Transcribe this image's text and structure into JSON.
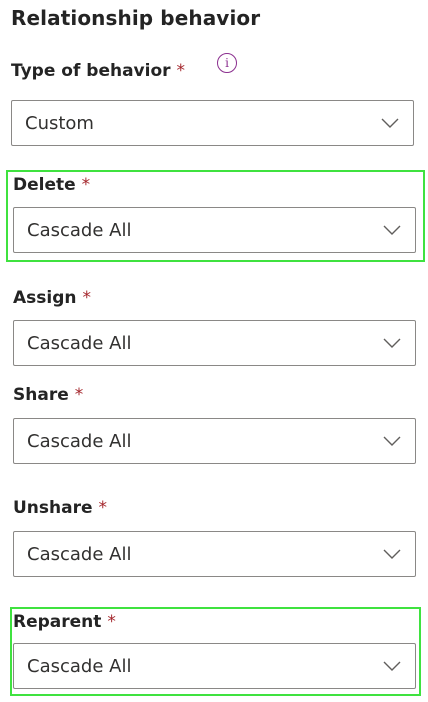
{
  "section": {
    "title": "Relationship behavior"
  },
  "required_mark": "*",
  "info_icon_glyph": "i",
  "fields": {
    "type_of_behavior": {
      "label": "Type of behavior",
      "value": "Custom"
    },
    "delete": {
      "label": "Delete",
      "value": "Cascade All"
    },
    "assign": {
      "label": "Assign",
      "value": "Cascade All"
    },
    "share": {
      "label": "Share",
      "value": "Cascade All"
    },
    "unshare": {
      "label": "Unshare",
      "value": "Cascade All"
    },
    "reparent": {
      "label": "Reparent",
      "value": "Cascade All"
    }
  },
  "colors": {
    "required": "#a4262c",
    "info_icon": "#8b2f8f",
    "highlight": "#3fe23f",
    "border": "#8a8886"
  },
  "icons": {
    "info": "info-icon",
    "chevron": "chevron-down-icon"
  }
}
